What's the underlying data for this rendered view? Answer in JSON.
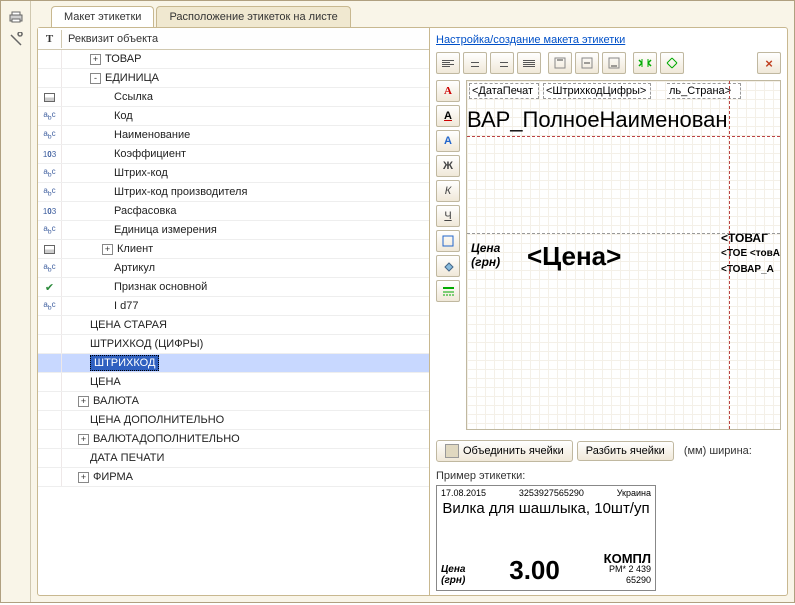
{
  "tabs": [
    {
      "label": "Макет этикетки"
    },
    {
      "label": "Расположение этикеток на листе"
    }
  ],
  "tree": {
    "header_icon": "T",
    "header_label": "Реквизит объекта",
    "rows": [
      {
        "icon": "",
        "indent": 24,
        "expander": "+",
        "label": "ТОВАР"
      },
      {
        "icon": "",
        "indent": 24,
        "expander": "-",
        "label": "ЕДИНИЦА"
      },
      {
        "icon": "table",
        "indent": 48,
        "label": "Ссылка"
      },
      {
        "icon": "abc",
        "indent": 48,
        "label": "Код"
      },
      {
        "icon": "abc",
        "indent": 48,
        "label": "Наименование"
      },
      {
        "icon": "103",
        "indent": 48,
        "label": "Коэффициент"
      },
      {
        "icon": "abc",
        "indent": 48,
        "label": "Штрих-код"
      },
      {
        "icon": "abc",
        "indent": 48,
        "label": "Штрих-код производителя"
      },
      {
        "icon": "103",
        "indent": 48,
        "label": "Расфасовка"
      },
      {
        "icon": "abc",
        "indent": 48,
        "label": "Единица измерения"
      },
      {
        "icon": "table",
        "indent": 36,
        "expander": "+",
        "label": "Клиент"
      },
      {
        "icon": "abc",
        "indent": 48,
        "label": "Артикул"
      },
      {
        "icon": "check",
        "indent": 48,
        "label": "Признак основной"
      },
      {
        "icon": "abc",
        "indent": 48,
        "label": "I d77"
      },
      {
        "icon": "",
        "indent": 24,
        "label": "ЦЕНА СТАРАЯ"
      },
      {
        "icon": "",
        "indent": 24,
        "label": "ШТРИХКОД (ЦИФРЫ)"
      },
      {
        "icon": "",
        "indent": 24,
        "label": "ШТРИХКОД",
        "selected": true
      },
      {
        "icon": "",
        "indent": 24,
        "label": "ЦЕНА"
      },
      {
        "icon": "",
        "indent": 12,
        "expander": "+",
        "label": "ВАЛЮТА"
      },
      {
        "icon": "",
        "indent": 24,
        "label": "ЦЕНА ДОПОЛНИТЕЛЬНО"
      },
      {
        "icon": "",
        "indent": 12,
        "expander": "+",
        "label": "ВАЛЮТАДОПОЛНИТЕЛЬНО"
      },
      {
        "icon": "",
        "indent": 24,
        "label": "ДАТА ПЕЧАТИ"
      },
      {
        "icon": "",
        "indent": 12,
        "expander": "+",
        "label": "ФИРМА"
      }
    ]
  },
  "right": {
    "link": "Настройка/создание макета этикетки",
    "fields": {
      "f1": "<ДатаПечат",
      "f2": "<ШтрихкодЦифры>",
      "f3": "ль_Страна>",
      "big": "ВАР_ПолноеНаименован",
      "price_lbl1": "Цена",
      "price_lbl2": "(грн)",
      "price_big": "<Цена>",
      "r1": "<ТОВАГ",
      "r2": "<ТОЕ <товА",
      "r3": "<ТОВАР_А"
    },
    "merge_btn": "Объединить ячейки",
    "split_btn": "Разбить ячейки",
    "width_label": "(мм) ширина:"
  },
  "preview": {
    "title": "Пример этикетки:",
    "date": "17.08.2015",
    "barcode": "3253927565290",
    "country": "Украина",
    "name": "Вилка для шашлыка, 10шт/уп",
    "price_lbl1": "Цена",
    "price_lbl2": "(грн)",
    "price": "3.00",
    "unit": "КОМПЛ",
    "pm": "PM*   2 439",
    "pm2": "65290"
  },
  "format_buttons": {
    "bold": "Ж",
    "italic": "К",
    "underline": "Ч"
  }
}
